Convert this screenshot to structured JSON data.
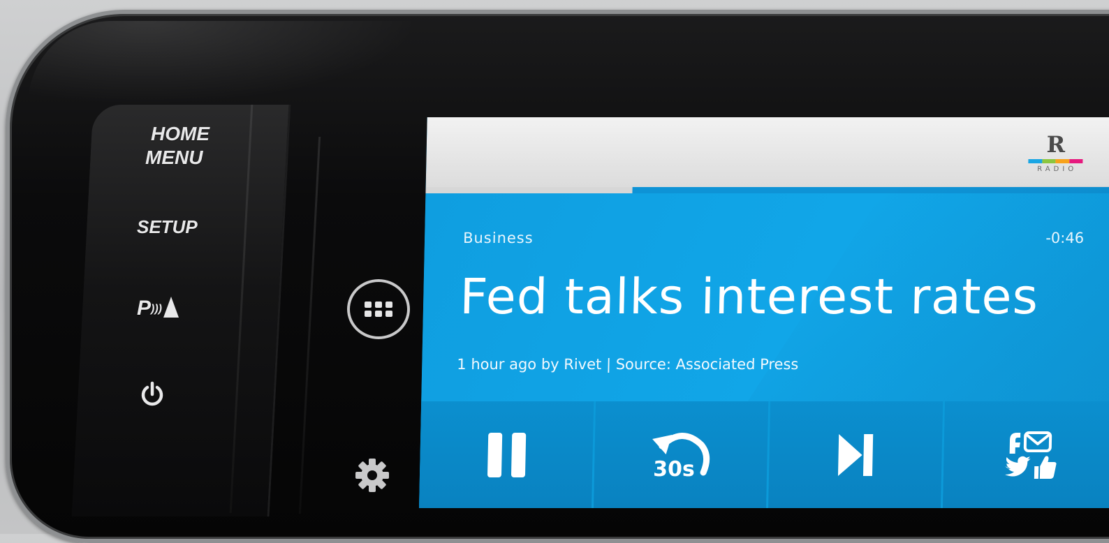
{
  "hardware": {
    "home_line1": "HOME",
    "home_line2": "MENU",
    "setup": "SETUP",
    "park_letter": "P"
  },
  "header": {
    "logo_letter": "R",
    "logo_word": "RADIO",
    "logo_colors": [
      "#1aa6e4",
      "#8cc63f",
      "#f7a21b",
      "#e6197e"
    ]
  },
  "playback": {
    "progress_fraction": 0.3,
    "category": "Business",
    "remaining": "-0:46",
    "headline": "Fed talks interest rates",
    "meta": "1 hour ago by Rivet | Source: Associated Press",
    "rewind_label": "30s"
  },
  "colors": {
    "accent": "#0b9fe0"
  }
}
